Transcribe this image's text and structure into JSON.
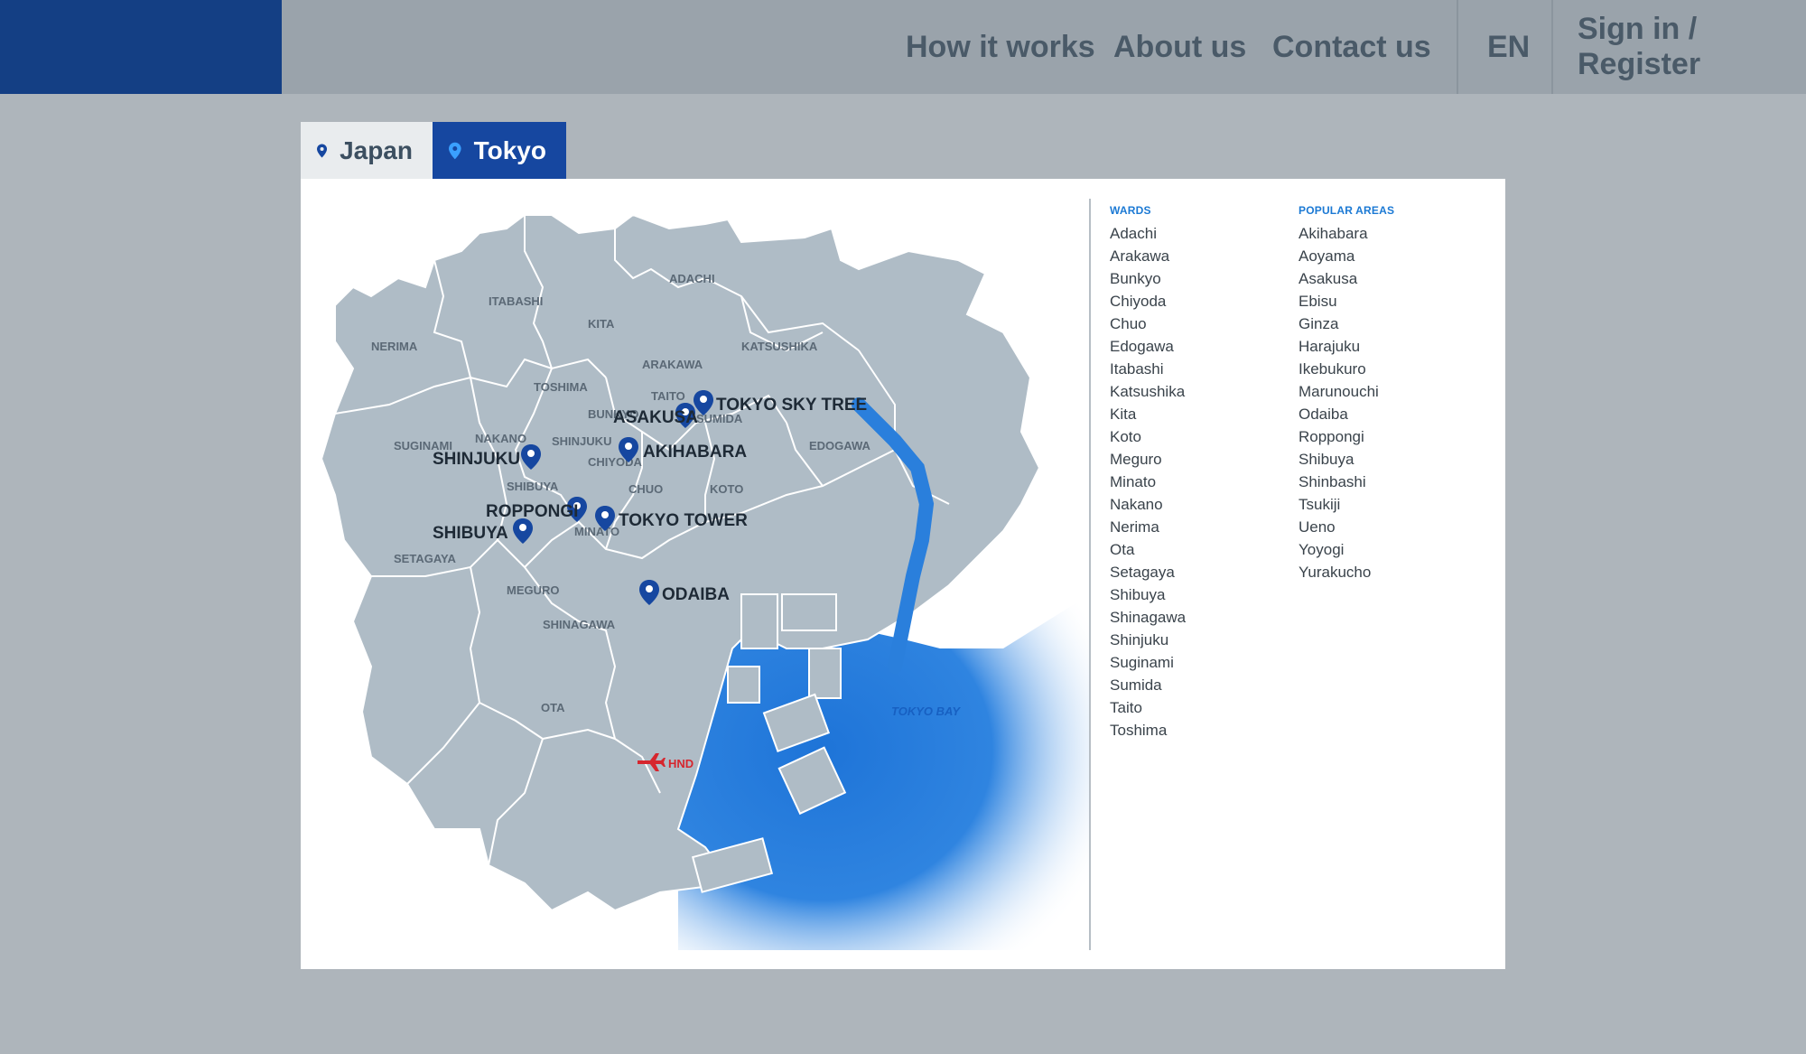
{
  "header": {
    "nav": [
      "How it works",
      "About us",
      "Contact us"
    ],
    "language": "EN",
    "auth": "Sign in / Register"
  },
  "tabs": [
    {
      "label": "Japan",
      "active": false
    },
    {
      "label": "Tokyo",
      "active": true
    }
  ],
  "map": {
    "ward_labels": [
      "ADACHI",
      "ITABASHI",
      "KITA",
      "NERIMA",
      "KATSUSHIKA",
      "ARAKAWA",
      "TOSHIMA",
      "TAITO",
      "BUNKYO",
      "SUMIDA",
      "NAKANO",
      "SHINJUKU",
      "SUGINAMI",
      "CHIYODA",
      "EDOGAWA",
      "SHIBUYA",
      "CHUO",
      "KOTO",
      "MINATO",
      "SETAGAYA",
      "MEGURO",
      "SHINAGAWA",
      "OTA"
    ],
    "landmarks": [
      "TOKYO SKY TREE",
      "ASAKUSA",
      "AKIHABARA",
      "SHINJUKU",
      "ROPPONGI",
      "TOKYO TOWER",
      "SHIBUYA",
      "ODAIBA"
    ],
    "bay_label": "TOKYO BAY",
    "airport_label": "HND"
  },
  "wards": {
    "heading": "WARDS",
    "items": [
      "Adachi",
      "Arakawa",
      "Bunkyo",
      "Chiyoda",
      "Chuo",
      "Edogawa",
      "Itabashi",
      "Katsushika",
      "Kita",
      "Koto",
      "Meguro",
      "Minato",
      "Nakano",
      "Nerima",
      "Ota",
      "Setagaya",
      "Shibuya",
      "Shinagawa",
      "Shinjuku",
      "Suginami",
      "Sumida",
      "Taito",
      "Toshima"
    ]
  },
  "popular_areas": {
    "heading": "POPULAR AREAS",
    "items": [
      "Akihabara",
      "Aoyama",
      "Asakusa",
      "Ebisu",
      "Ginza",
      "Harajuku",
      "Ikebukuro",
      "Marunouchi",
      "Odaiba",
      "Roppongi",
      "Shibuya",
      "Shinbashi",
      "Tsukiji",
      "Ueno",
      "Yoyogi",
      "Yurakucho"
    ]
  },
  "colors": {
    "brand": "#143f84",
    "active_tab": "#1647a0",
    "land": "#afbcc6",
    "water": "#1e74d8",
    "airport": "#d6262e",
    "heading_accent": "#1b79d4"
  }
}
